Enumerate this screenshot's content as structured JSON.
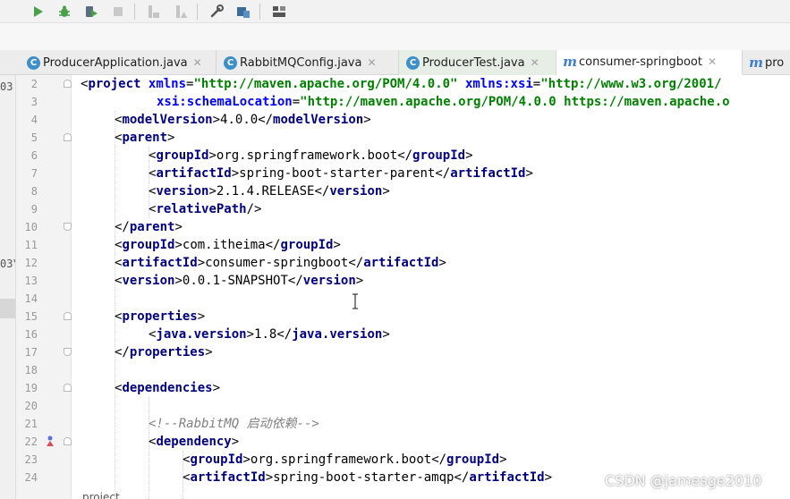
{
  "toolbar": {
    "buttons": [
      "run-icon",
      "debug-icon",
      "coverage-icon",
      "stop-icon",
      "build-icon",
      "build-project-icon",
      "wrench-icon",
      "project-structure-icon",
      "layout-icon"
    ]
  },
  "tabs": [
    {
      "label": "ProducerApplication.java",
      "icon": "C"
    },
    {
      "label": "RabbitMQConfig.java",
      "icon": "C"
    },
    {
      "label": "ProducerTest.java",
      "icon": "C"
    },
    {
      "label": "consumer-springboot",
      "icon": "m"
    },
    {
      "label": "pro",
      "icon": "m"
    }
  ],
  "left_strip": {
    "line1": "03",
    "line2": "03\\"
  },
  "line_numbers": [
    "2",
    "3",
    "4",
    "5",
    "6",
    "7",
    "8",
    "9",
    "10",
    "11",
    "12",
    "13",
    "14",
    "15",
    "16",
    "17",
    "18",
    "19",
    "20",
    "21",
    "22",
    "23",
    "24"
  ],
  "code": {
    "l2": {
      "t": "project",
      "a1": "xmlns",
      "s1": "\"http://maven.apache.org/POM/4.0.0\"",
      "a2": "xmlns:xsi",
      "s2": "\"http://www.w3.org/2001/"
    },
    "l3": {
      "a": "xsi:schemaLocation",
      "s": "\"http://maven.apache.org/POM/4.0.0 https://maven.apache.o"
    },
    "l4": {
      "t": "modelVersion",
      "v": "4.0.0"
    },
    "l5": {
      "t": "parent"
    },
    "l6": {
      "t": "groupId",
      "v": "org.springframework.boot"
    },
    "l7": {
      "t": "artifactId",
      "v": "spring-boot-starter-parent"
    },
    "l8": {
      "t": "version",
      "v": "2.1.4.RELEASE"
    },
    "l9": {
      "t": "relativePath"
    },
    "l10": {
      "t": "parent"
    },
    "l11": {
      "t": "groupId",
      "v": "com.itheima"
    },
    "l12": {
      "t": "artifactId",
      "v": "consumer-springboot"
    },
    "l13": {
      "t": "version",
      "v": "0.0.1-SNAPSHOT"
    },
    "l15": {
      "t": "properties"
    },
    "l16": {
      "t": "java.version",
      "v": "1.8"
    },
    "l17": {
      "t": "properties"
    },
    "l19": {
      "t": "dependencies"
    },
    "l21": {
      "c": "<!--RabbitMQ 启动依赖-->"
    },
    "l22": {
      "t": "dependency"
    },
    "l23": {
      "t": "groupId",
      "v": "org.springframework.boot"
    },
    "l24": {
      "t": "artifactId",
      "v": "spring-boot-starter-amqp"
    }
  },
  "breadcrumb": "project",
  "watermark": "CSDN @jamesge2010"
}
